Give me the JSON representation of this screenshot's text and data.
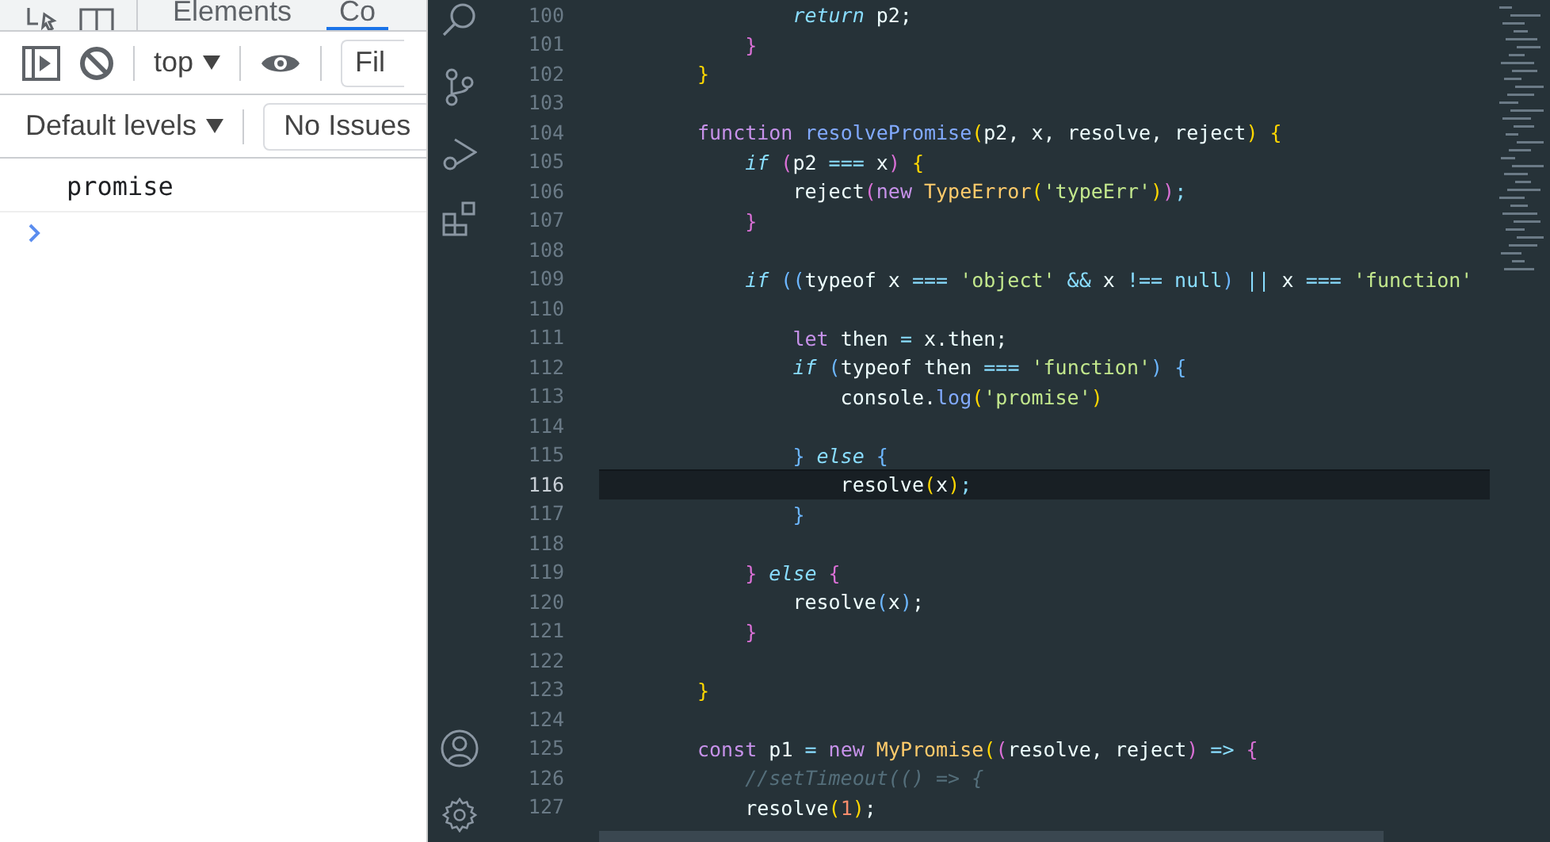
{
  "devtools": {
    "tabs": [
      {
        "label": "Elements",
        "selected": false
      },
      {
        "label": "Co",
        "selected": true
      }
    ],
    "context": "top",
    "filter": {
      "placeholder": "Fil"
    },
    "levels": "Default levels",
    "issues": "No Issues",
    "messages": [
      "promise"
    ]
  },
  "editor": {
    "lines": [
      {
        "num": "100",
        "current": false,
        "tokens": [
          {
            "kind": "ctl",
            "text": "        return"
          },
          {
            "kind": "id",
            "text": " p2;"
          }
        ]
      },
      {
        "num": "101",
        "current": false,
        "tokens": [
          {
            "kind": "p2",
            "text": "    }"
          }
        ]
      },
      {
        "num": "102",
        "current": false,
        "tokens": [
          {
            "kind": "p1",
            "text": "}"
          }
        ]
      },
      {
        "num": "103",
        "current": false
      },
      {
        "num": "104",
        "current": false,
        "tokens": [
          {
            "kind": "kw",
            "text": "function"
          },
          {
            "kind": "fn",
            "text": " resolvePromise"
          },
          {
            "kind": "p1",
            "text": "("
          },
          {
            "kind": "id",
            "text": "p2, x, resolve, reject"
          },
          {
            "kind": "p1",
            "text": ") {"
          }
        ]
      },
      {
        "num": "105",
        "current": false,
        "tokens": [
          {
            "kind": "ctl",
            "text": "    if"
          },
          {
            "kind": "p2",
            "text": " ("
          },
          {
            "kind": "id",
            "text": "p2 "
          },
          {
            "kind": "op",
            "text": "==="
          },
          {
            "kind": "id",
            "text": " x"
          },
          {
            "kind": "p2",
            "text": ")"
          },
          {
            "kind": "p1",
            "text": " {"
          }
        ]
      },
      {
        "num": "106",
        "current": false,
        "tokens": [
          {
            "kind": "id",
            "text": "        reject"
          },
          {
            "kind": "p2",
            "text": "("
          },
          {
            "kind": "kw",
            "text": "new"
          },
          {
            "kind": "cls",
            "text": " TypeError"
          },
          {
            "kind": "p1",
            "text": "("
          },
          {
            "kind": "str",
            "text": "'typeErr'"
          },
          {
            "kind": "p1",
            "text": ")"
          },
          {
            "kind": "p2",
            "text": ")"
          },
          {
            "kind": "op",
            "text": ";"
          }
        ]
      },
      {
        "num": "107",
        "current": false,
        "tokens": [
          {
            "kind": "p2",
            "text": "    }"
          }
        ]
      },
      {
        "num": "108",
        "current": false
      },
      {
        "num": "109",
        "current": false,
        "tokens": [
          {
            "kind": "ctl",
            "text": "    if"
          },
          {
            "kind": "p3",
            "text": " (("
          },
          {
            "kind": "id",
            "text": "typeof x "
          },
          {
            "kind": "op",
            "text": "==="
          },
          {
            "kind": "str",
            "text": " 'object'"
          },
          {
            "kind": "op",
            "text": " &&"
          },
          {
            "kind": "id",
            "text": " x "
          },
          {
            "kind": "op",
            "text": "!=="
          },
          {
            "kind": "op",
            "text": " null"
          },
          {
            "kind": "p3",
            "text": ")"
          },
          {
            "kind": "op",
            "text": " ||"
          },
          {
            "kind": "id",
            "text": " x "
          },
          {
            "kind": "op",
            "text": "==="
          },
          {
            "kind": "str",
            "text": " 'function'"
          }
        ]
      },
      {
        "num": "110",
        "current": false
      },
      {
        "num": "111",
        "current": false,
        "tokens": [
          {
            "kind": "kw",
            "text": "        let"
          },
          {
            "kind": "id",
            "text": " then "
          },
          {
            "kind": "op",
            "text": "="
          },
          {
            "kind": "id",
            "text": " x.then;"
          }
        ]
      },
      {
        "num": "112",
        "current": false,
        "tokens": [
          {
            "kind": "ctl",
            "text": "        if"
          },
          {
            "kind": "p3",
            "text": " ("
          },
          {
            "kind": "id",
            "text": "typeof then "
          },
          {
            "kind": "op",
            "text": "==="
          },
          {
            "kind": "str",
            "text": " 'function'"
          },
          {
            "kind": "p3",
            "text": ") {"
          }
        ]
      },
      {
        "num": "113",
        "current": false,
        "tokens": [
          {
            "kind": "id",
            "text": "            console."
          },
          {
            "kind": "fn",
            "text": "log"
          },
          {
            "kind": "p1",
            "text": "("
          },
          {
            "kind": "str",
            "text": "'promise'"
          },
          {
            "kind": "p1",
            "text": ")"
          }
        ]
      },
      {
        "num": "114",
        "current": false
      },
      {
        "num": "115",
        "current": false,
        "tokens": [
          {
            "kind": "p3",
            "text": "        }"
          },
          {
            "kind": "ctl",
            "text": " else"
          },
          {
            "kind": "p3",
            "text": " {"
          }
        ]
      },
      {
        "num": "116",
        "current": true,
        "tokens": [
          {
            "kind": "id",
            "text": "            resolve"
          },
          {
            "kind": "p1",
            "text": "("
          },
          {
            "kind": "id",
            "text": "x"
          },
          {
            "kind": "p1",
            "text": ")"
          },
          {
            "kind": "op",
            "text": ";"
          }
        ]
      },
      {
        "num": "117",
        "current": false,
        "tokens": [
          {
            "kind": "p3",
            "text": "        }"
          }
        ]
      },
      {
        "num": "118",
        "current": false
      },
      {
        "num": "119",
        "current": false,
        "tokens": [
          {
            "kind": "p2",
            "text": "    }"
          },
          {
            "kind": "ctl",
            "text": " else"
          },
          {
            "kind": "p2",
            "text": " {"
          }
        ]
      },
      {
        "num": "120",
        "current": false,
        "tokens": [
          {
            "kind": "id",
            "text": "        resolve"
          },
          {
            "kind": "p3",
            "text": "("
          },
          {
            "kind": "id",
            "text": "x"
          },
          {
            "kind": "p3",
            "text": ")"
          },
          {
            "kind": "id",
            "text": ";"
          }
        ]
      },
      {
        "num": "121",
        "current": false,
        "tokens": [
          {
            "kind": "p2",
            "text": "    }"
          }
        ]
      },
      {
        "num": "122",
        "current": false
      },
      {
        "num": "123",
        "current": false,
        "tokens": [
          {
            "kind": "p1",
            "text": "}"
          }
        ]
      },
      {
        "num": "124",
        "current": false
      },
      {
        "num": "125",
        "current": false,
        "tokens": [
          {
            "kind": "kw",
            "text": "const"
          },
          {
            "kind": "id",
            "text": " p1 "
          },
          {
            "kind": "op",
            "text": "="
          },
          {
            "kind": "kw",
            "text": " new"
          },
          {
            "kind": "cls",
            "text": " MyPromise"
          },
          {
            "kind": "p1",
            "text": "("
          },
          {
            "kind": "p2",
            "text": "("
          },
          {
            "kind": "id",
            "text": "resolve, reject"
          },
          {
            "kind": "p2",
            "text": ")"
          },
          {
            "kind": "op",
            "text": " =>"
          },
          {
            "kind": "p2",
            "text": " {"
          }
        ]
      },
      {
        "num": "126",
        "current": false,
        "tokens": [
          {
            "kind": "cmt",
            "text": "    //setTimeout(() => {"
          }
        ]
      },
      {
        "num": "127",
        "current": false,
        "tokens": [
          {
            "kind": "id",
            "text": "    resolve"
          },
          {
            "kind": "p1",
            "text": "("
          },
          {
            "kind": "num",
            "text": "1"
          },
          {
            "kind": "p1",
            "text": ")"
          },
          {
            "kind": "id",
            "text": ";"
          }
        ]
      }
    ]
  }
}
